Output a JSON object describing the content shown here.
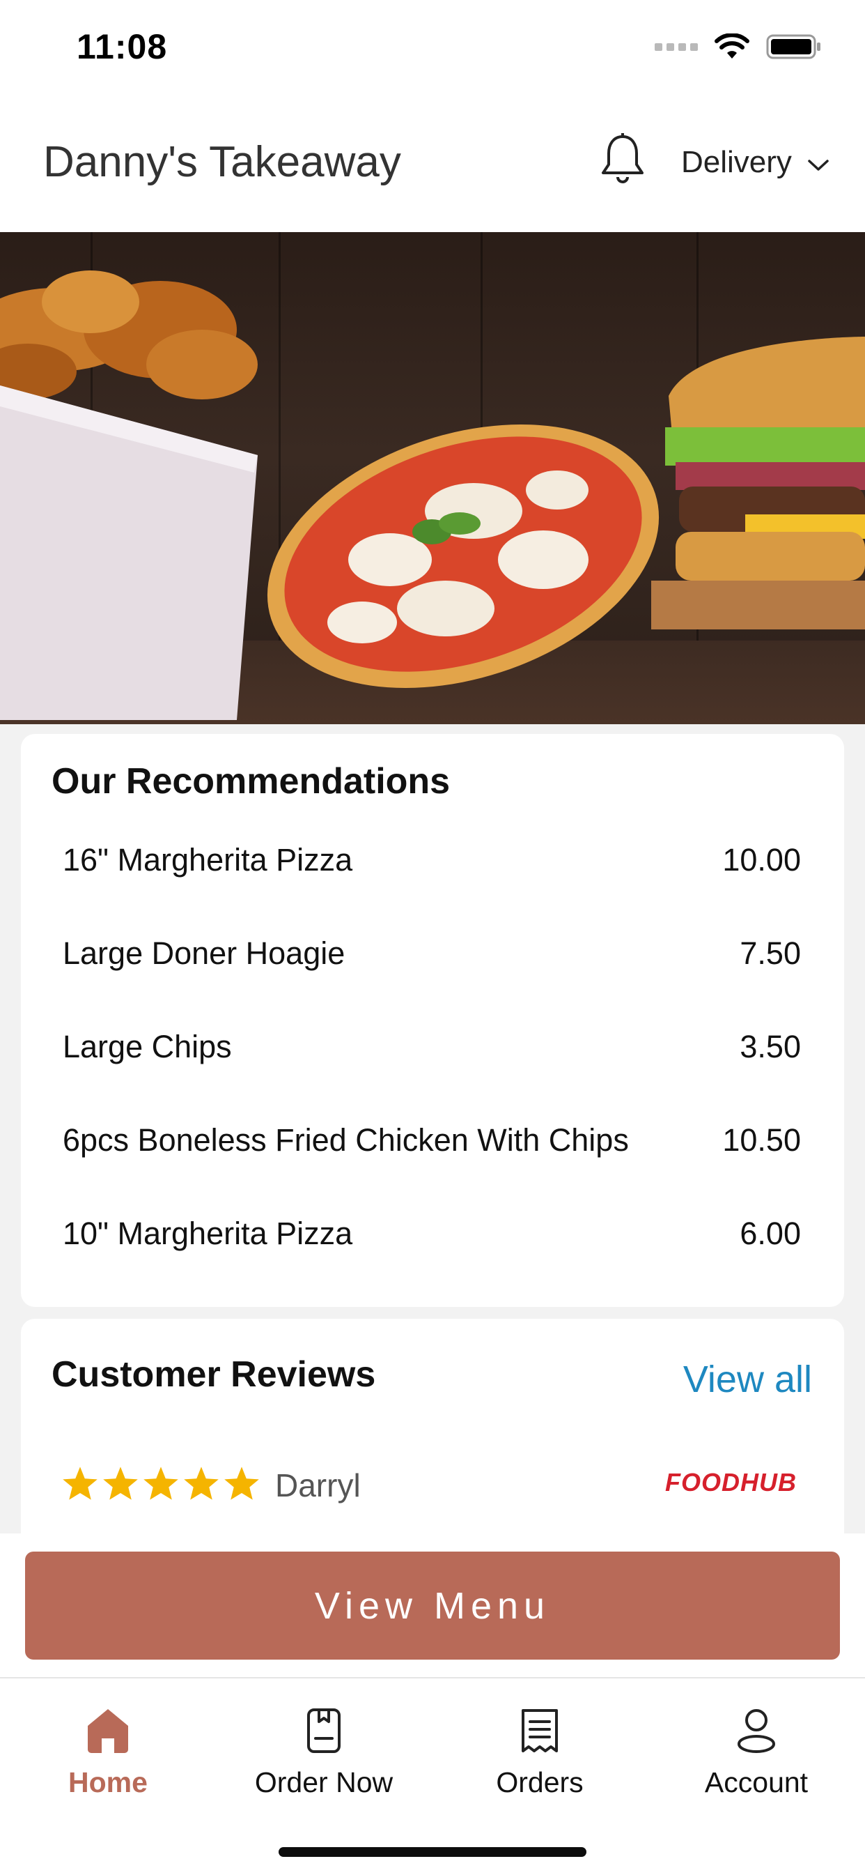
{
  "status_bar": {
    "time": "11:08"
  },
  "header": {
    "title": "Danny's Takeaway",
    "order_type": "Delivery"
  },
  "recommendations": {
    "title": "Our Recommendations",
    "items": [
      {
        "name": "16\" Margherita Pizza",
        "price": "10.00"
      },
      {
        "name": "Large Doner Hoagie",
        "price": "7.50"
      },
      {
        "name": "Large Chips",
        "price": "3.50"
      },
      {
        "name": "6pcs Boneless Fried Chicken With Chips",
        "price": "10.50"
      },
      {
        "name": "10\" Margherita Pizza",
        "price": "6.00"
      }
    ]
  },
  "reviews": {
    "title": "Customer Reviews",
    "view_all": "View all",
    "first": {
      "rating": 5,
      "reviewer": "Darryl",
      "source": "FOODHUB"
    }
  },
  "view_menu_label": "View Menu",
  "tabs": [
    {
      "label": "Home",
      "icon": "home-icon",
      "active": true
    },
    {
      "label": "Order Now",
      "icon": "order-now-icon",
      "active": false
    },
    {
      "label": "Orders",
      "icon": "receipt-icon",
      "active": false
    },
    {
      "label": "Account",
      "icon": "account-icon",
      "active": false
    }
  ],
  "colors": {
    "accent": "#b86a58",
    "link": "#1e88c0",
    "star": "#f5b400"
  }
}
